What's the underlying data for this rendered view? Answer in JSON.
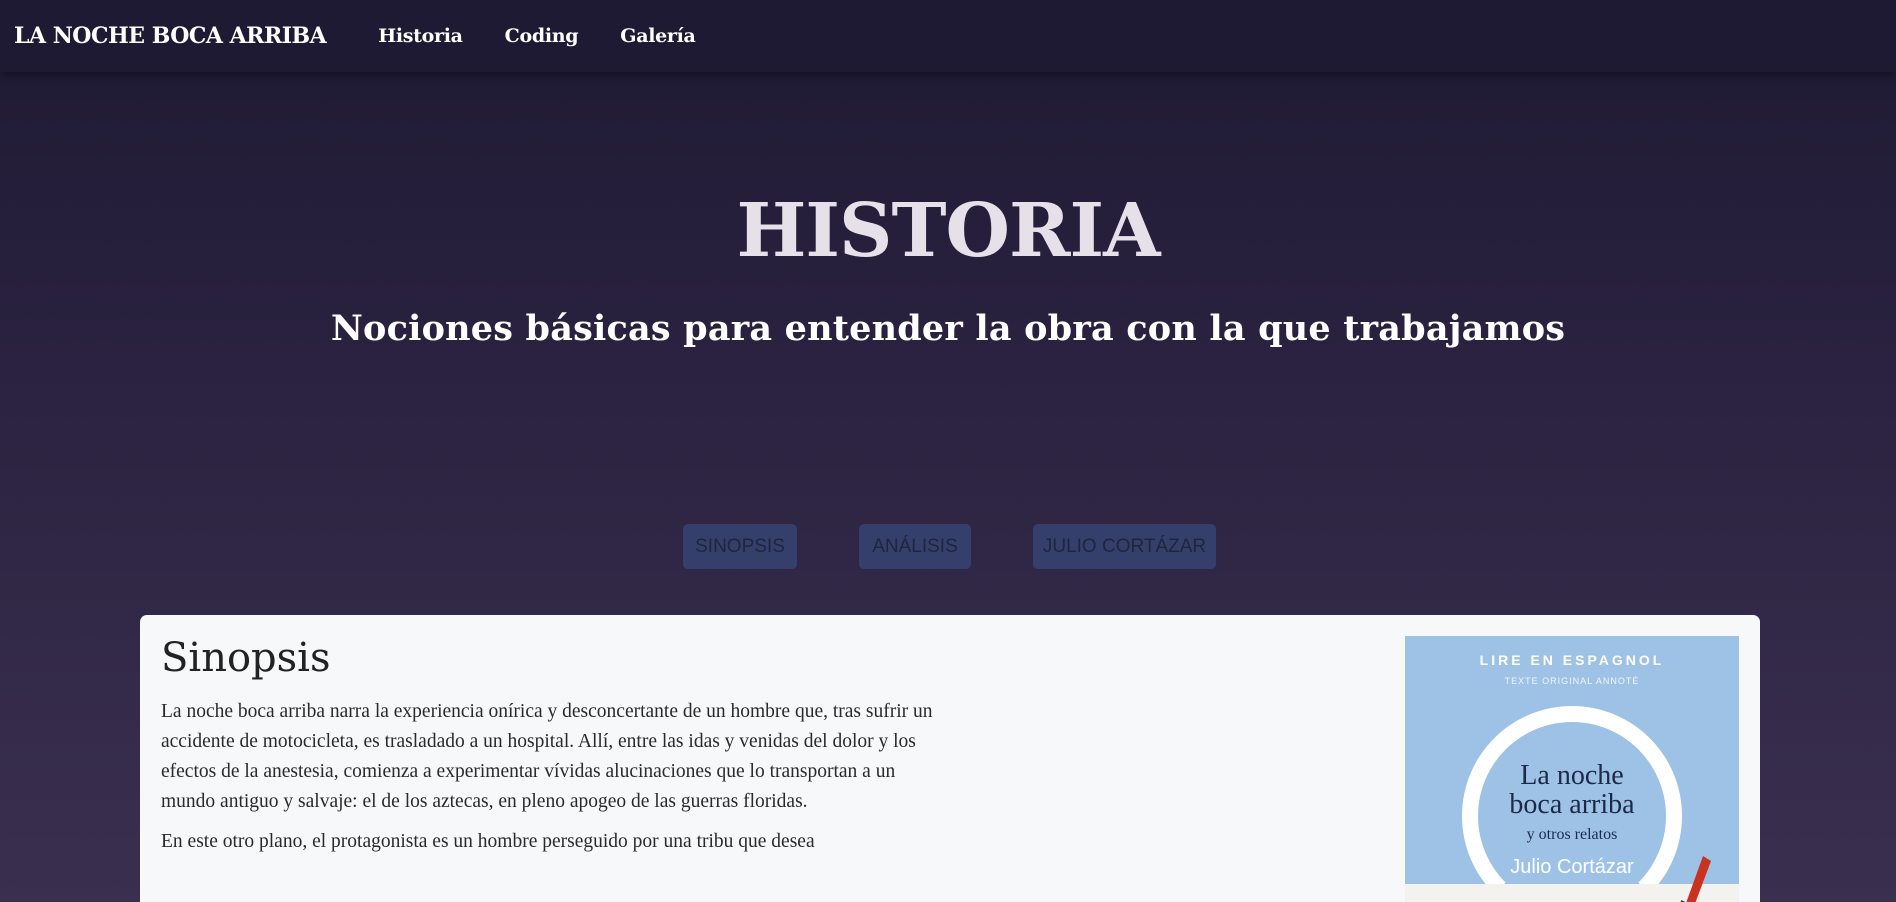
{
  "navbar": {
    "brand": "LA NOCHE BOCA ARRIBA",
    "links": [
      "Historia",
      "Coding",
      "Galería"
    ]
  },
  "hero": {
    "title": "HISTORIA",
    "subtitle": "Nociones básicas para entender la obra con la que trabajamos"
  },
  "sections": {
    "buttons": [
      "SINOPSIS",
      "ANÁLISIS",
      "JULIO CORTÁZAR"
    ]
  },
  "card": {
    "title": "Sinopsis",
    "paragraphs": [
      "La noche boca arriba narra la experiencia onírica y desconcertante de un hombre que, tras sufrir un accidente de motocicleta, es trasladado a un hospital. Allí, entre las idas y venidas del dolor y los efectos de la anestesia, comienza a experimentar vívidas alucinaciones que lo transportan a un mundo antiguo y salvaje: el de los aztecas, en pleno apogeo de las guerras floridas.",
      "En este otro plano, el protagonista es un hombre perseguido por una tribu que desea"
    ]
  },
  "cover": {
    "top": "LIRE EN ESPAGNOL",
    "sub": "TEXTE ORIGINAL ANNOTÉ",
    "title_line1": "La noche",
    "title_line2": "boca arriba",
    "subtitle": "y otros relatos",
    "author": "Julio Cortázar"
  },
  "colors": {
    "navbar_bg": "#1e1a33",
    "button_bg": "#34406b",
    "card_bg": "#f7f8fa",
    "cover_bg": "#9ec2e6"
  }
}
